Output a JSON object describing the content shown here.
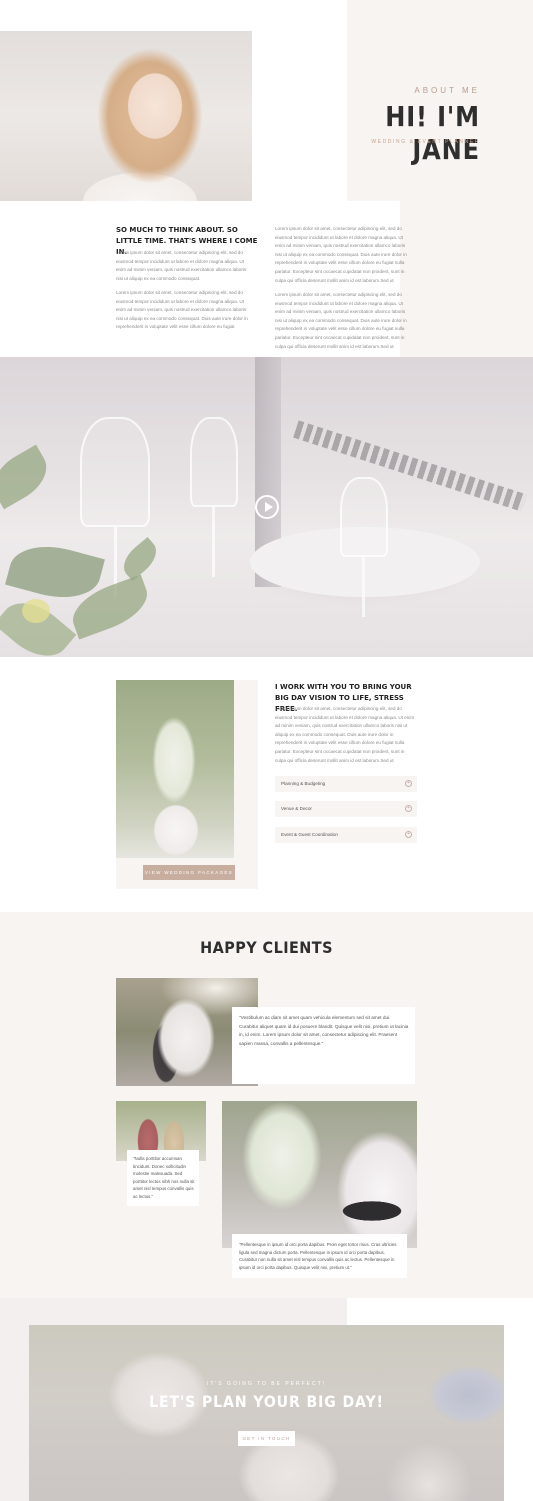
{
  "about": {
    "eyebrow": "ABOUT ME",
    "title": "HI! I'M JANE",
    "subtitle": "WEDDING & EVENT PLANNER",
    "intro_heading": "SO MUCH TO THINK ABOUT. SO LITTLE TIME. THAT'S WHERE I COME IN.",
    "paragraphs": [
      "Lorem ipsum dolor sit amet, consectetur adipiscing elit, sed do eiusmod tempor incididunt ut labore et dolore magna aliqua. Ut enim ad minim veniam, quis nostrud exercitation ullamco laboris nisi ut aliquip ex ea commodo consequat.",
      "Lorem ipsum dolor sit amet, consectetur adipiscing elit, sed do eiusmod tempor incididunt ut labore et dolore magna aliqua. Ut enim ad minim veniam, quis nostrud exercitation ullamco laboris nisi ut aliquip ex ea commodo consequat. Duis aute irure dolor in reprehenderit in voluptate velit esse cillum dolore eu fugiat",
      "Lorem ipsum dolor sit amet, consectetur adipiscing elit, sed do eiusmod tempor incididunt ut labore et dolore magna aliqua. Ut enim ad minim veniam, quis nostrud exercitation ullamco laboris nisi ut aliquip ex ea commodo consequat. Duis aute irure dolor in reprehenderit in voluptate velit esse cillum dolore eu fugiat nulla pariatur. Excepteur sint occaecat cupidatat non proident, sunt in culpa qui officia deserunt mollit anim id est laborum.Sed ut",
      "Lorem ipsum dolor sit amet, consectetur adipiscing elit, sed do eiusmod tempor incididunt ut labore et dolore magna aliqua. Ut enim ad minim veniam, quis nostrud exercitation ullamco laboris nisi ut aliquip ex ea commodo consequat. Duis aute irure dolor in reprehenderit in voluptate velit esse cillum dolore eu fugiat nulla pariatur. Excepteur sint occaecat cupidatat non proident, sunt in culpa qui officia deserunt mollit anim id est laborum.Sed ut"
    ]
  },
  "video": {
    "play_icon": "play-icon"
  },
  "services": {
    "heading": "I WORK WITH YOU TO BRING YOUR BIG DAY VISION TO LIFE, STRESS FREE.",
    "paragraph": "Lorem ipsum dolor sit amet, consectetur adipiscing elit, sed do eiusmod tempor incididunt ut labore et dolore magna aliqua. Ut enim ad minim veniam, quis nostrud exercitation ullamco laboris nisi ut aliquip ex ea commodo consequat. Duis aute irure dolor in reprehenderit in voluptate velit esse cillum dolore eu fugiat nulla pariatur. Excepteur sint occaecat cupidatat non proident, sunt in culpa qui officia deserunt mollit anim id est laborum.Sed ut",
    "button_label": "VIEW WEDDING PACKAGES",
    "accordion": [
      {
        "label": "Planning & Budgeting",
        "icon": "plus-circle-icon"
      },
      {
        "label": "Venue & Decor",
        "icon": "plus-circle-icon"
      },
      {
        "label": "Event & Guest Coordination",
        "icon": "plus-circle-icon"
      }
    ]
  },
  "clients": {
    "title": "HAPPY CLIENTS",
    "quotes": [
      "\"Vestibulum ac diam sit amet quam vehicula elementum sed sit amet dui. Curabitur aliquet quam id dui posuere blandit. Quisque velit nisi, pretium ut lacinia in, id enim. Lorem ipsum dolor sit amet, consectetur adipiscing elit. Praesent sapien massa, convallis a pellentesque.\"",
      "\"Nulla porttitor accumsan tincidunt. Donec sollicitudin molestie malesuada. Sed porttitor lectus nibh nos nulla sit amet nisl tempus convallis quis ac lectus.\"",
      "\"Pellentesque in ipsum id orci porta dapibus. Proin eget tortor risus. Cras ultricies ligula sed magna dictum porta. Pellentesque in ipsum id orci porta dapibus. Curabitur non nulla sit amet nisl tempus convallis quis ac lectus. Pellentesque in ipsum id orci porta dapibus. Quisque velit nisi, pretium ut.\""
    ]
  },
  "cta": {
    "eyebrow": "IT'S GOING TO BE PERFECT!",
    "title": "LET'S PLAN YOUR BIG DAY!",
    "button_label": "GET IN TOUCH"
  },
  "colors": {
    "accent": "#c8ae9e",
    "section_bg": "#f8f4f2",
    "heading": "#2e2e2e"
  }
}
